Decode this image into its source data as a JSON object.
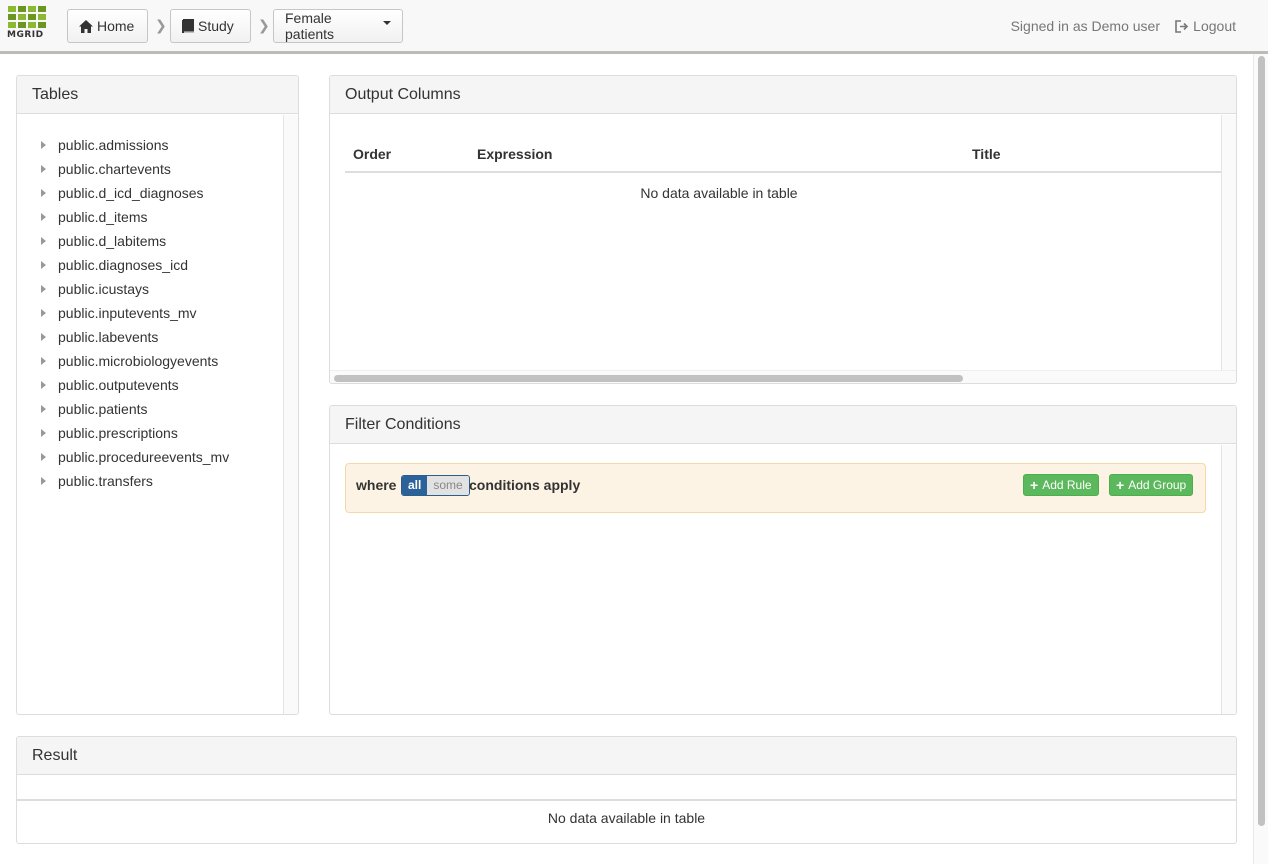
{
  "navbar": {
    "logo_text": "MGRID",
    "breadcrumbs": [
      {
        "label": "Home",
        "icon": "home-icon"
      },
      {
        "label": "Study",
        "icon": "book-icon"
      },
      {
        "label": "Female patients",
        "icon": "caret-down-icon"
      }
    ],
    "signed_in": "Signed in as Demo user",
    "logout_label": "Logout"
  },
  "tables_panel": {
    "title": "Tables",
    "items": [
      "public.admissions",
      "public.chartevents",
      "public.d_icd_diagnoses",
      "public.d_items",
      "public.d_labitems",
      "public.diagnoses_icd",
      "public.icustays",
      "public.inputevents_mv",
      "public.labevents",
      "public.microbiologyevents",
      "public.outputevents",
      "public.patients",
      "public.prescriptions",
      "public.procedureevents_mv",
      "public.transfers"
    ]
  },
  "output_panel": {
    "title": "Output Columns",
    "columns": [
      "Order",
      "Expression",
      "Title"
    ],
    "empty_text": "No data available in table"
  },
  "filter_panel": {
    "title": "Filter Conditions",
    "where_label": "where",
    "toggle_all": "all",
    "toggle_some": "some",
    "conditions_label": "conditions apply",
    "add_rule_label": "Add Rule",
    "add_group_label": "Add Group"
  },
  "result_panel": {
    "title": "Result",
    "empty_text": "No data available in table"
  },
  "colors": {
    "brand_green": "#8db832",
    "button_green": "#5cb85c",
    "toggle_blue": "#2a6299",
    "rule_group_bg": "#fcf3e4"
  }
}
